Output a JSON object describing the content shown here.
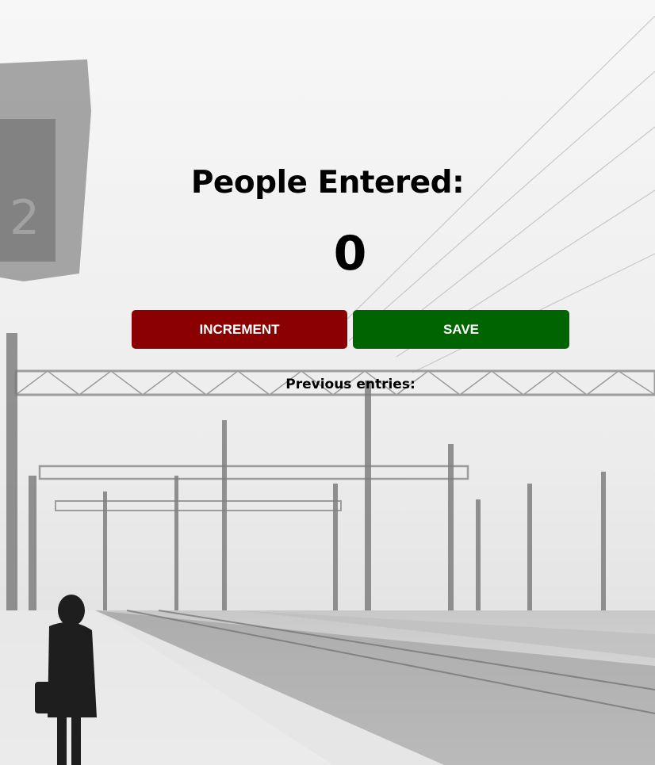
{
  "counter": {
    "title": "People Entered:",
    "value": "0"
  },
  "buttons": {
    "increment_label": "INCREMENT",
    "save_label": "SAVE"
  },
  "history": {
    "heading": "Previous entries:",
    "entries": []
  },
  "colors": {
    "increment": "#8b0000",
    "save": "#006400"
  }
}
